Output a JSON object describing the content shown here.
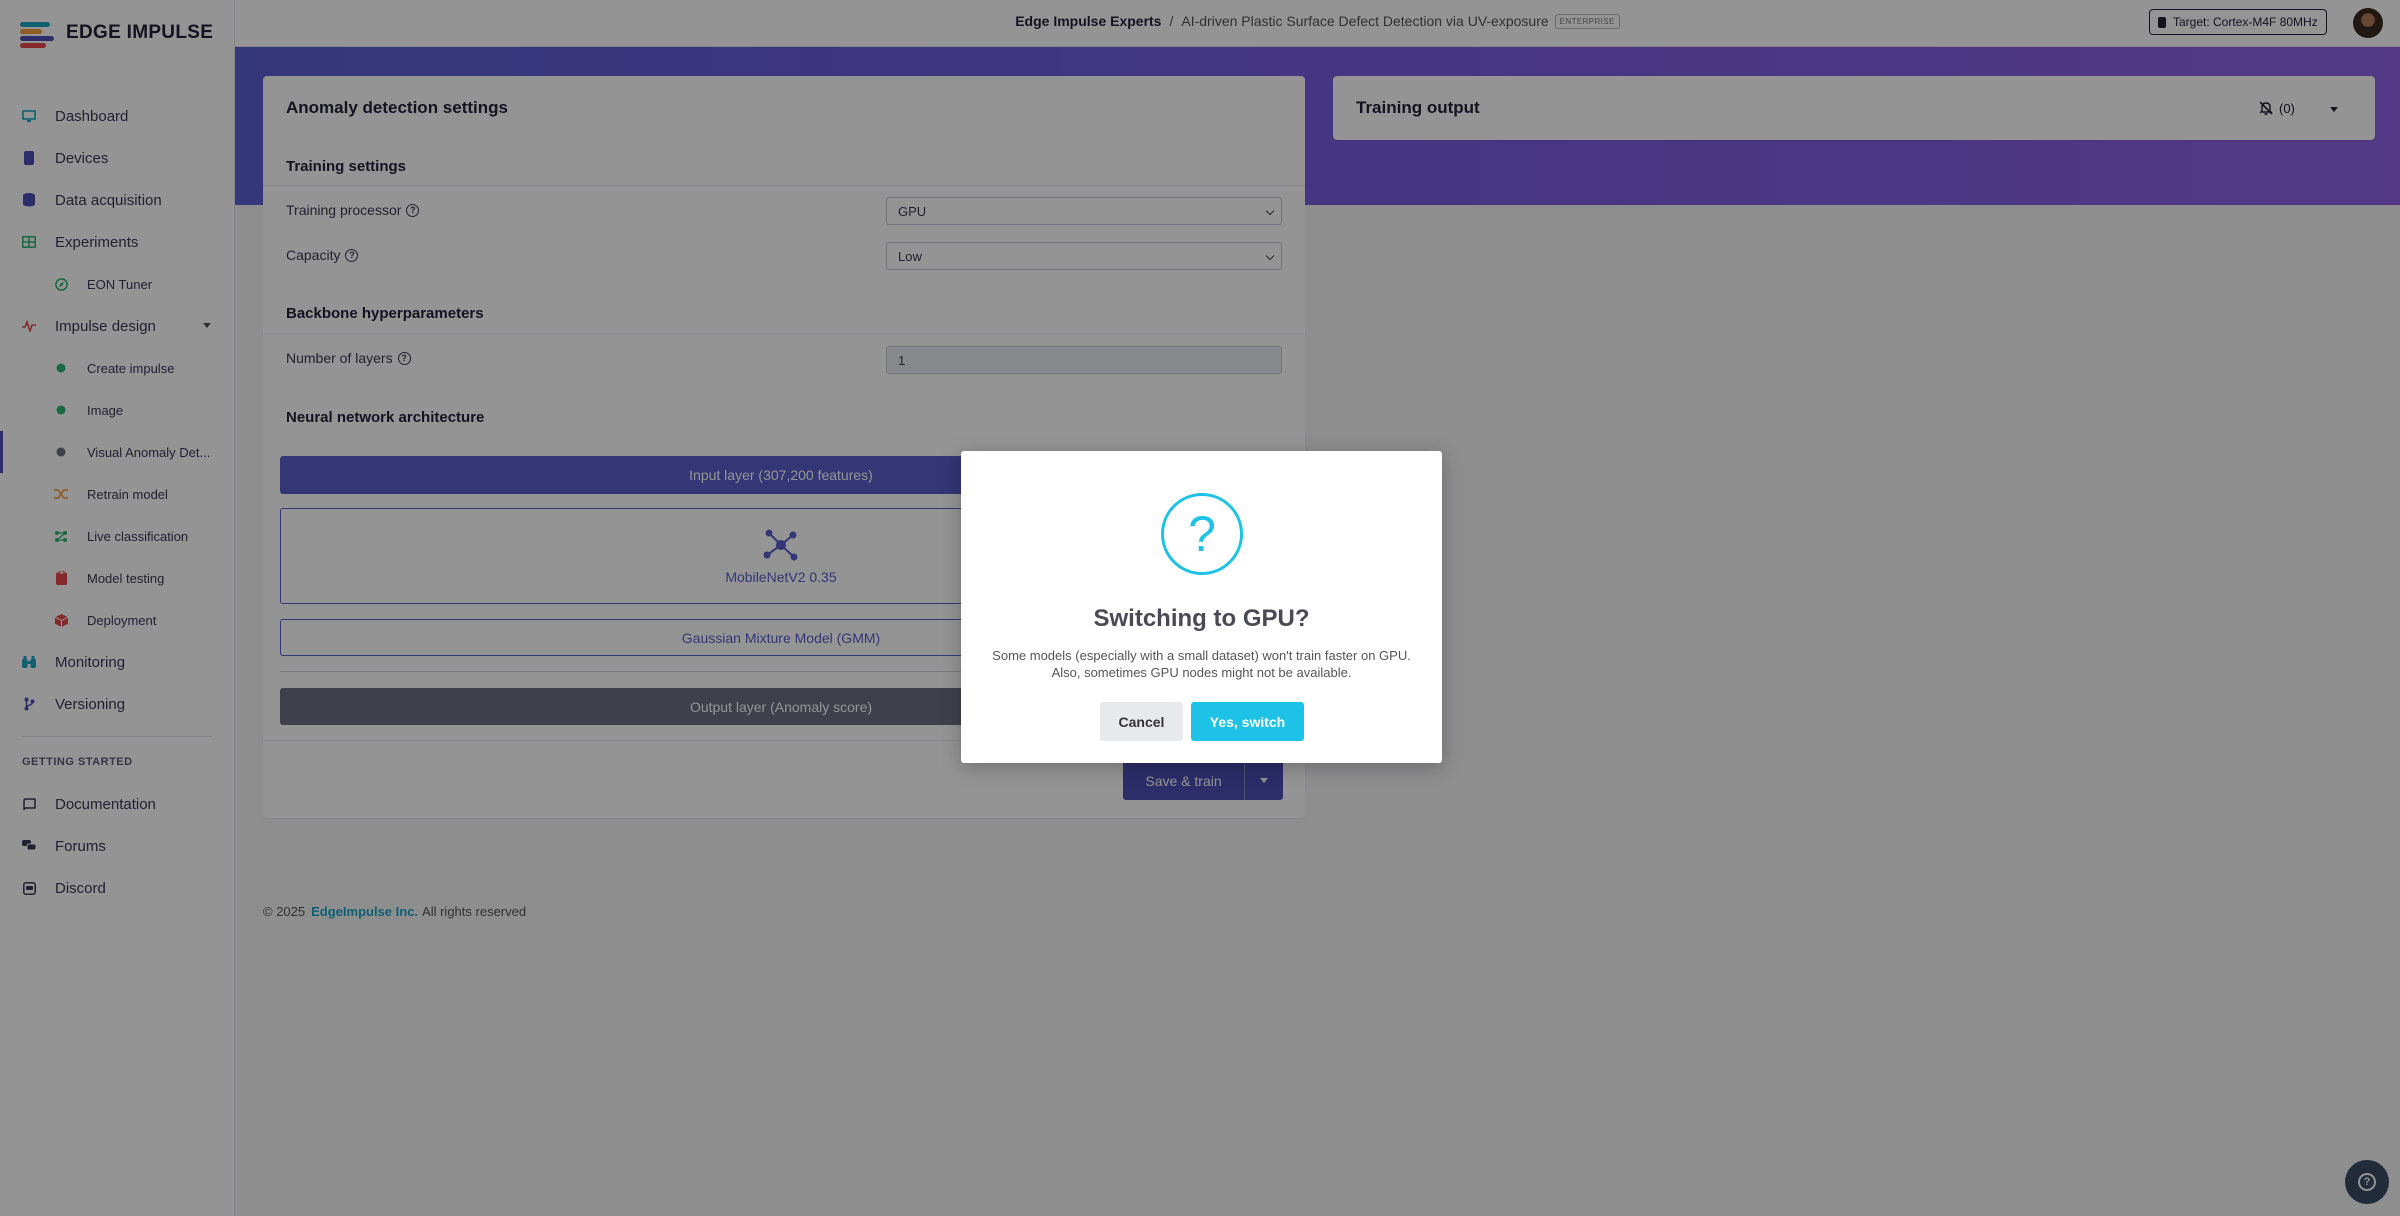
{
  "brand": {
    "name": "EDGE IMPULSE",
    "logo_colors": [
      "#1ea6c4",
      "#f3a33b",
      "#4d4fb5",
      "#e5484d"
    ]
  },
  "sidebar": {
    "items": [
      {
        "label": "Dashboard",
        "icon": "monitor-icon",
        "color": "#1ea6c4"
      },
      {
        "label": "Devices",
        "icon": "device-icon",
        "color": "#4d4fb5"
      },
      {
        "label": "Data acquisition",
        "icon": "database-icon",
        "color": "#4d4fb5"
      },
      {
        "label": "Experiments",
        "icon": "grid-icon",
        "color": "#2bb673"
      },
      {
        "label": "EON Tuner",
        "icon": "compass-icon",
        "color": "#2bb673"
      },
      {
        "label": "Impulse design",
        "icon": "pulse-icon",
        "color": "#e5484d"
      },
      {
        "label": "Create impulse",
        "icon": "dot-icon",
        "color": "#2bb673"
      },
      {
        "label": "Image",
        "icon": "dot-icon",
        "color": "#2bb673"
      },
      {
        "label": "Visual Anomaly Det...",
        "icon": "dot-icon",
        "color": "#6c6f82"
      },
      {
        "label": "Retrain model",
        "icon": "shuffle-icon",
        "color": "#f3a33b"
      },
      {
        "label": "Live classification",
        "icon": "network-icon",
        "color": "#2bb673"
      },
      {
        "label": "Model testing",
        "icon": "clipboard-icon",
        "color": "#e5484d"
      },
      {
        "label": "Deployment",
        "icon": "box-icon",
        "color": "#e5484d"
      },
      {
        "label": "Monitoring",
        "icon": "binoculars-icon",
        "color": "#1ea6c4"
      },
      {
        "label": "Versioning",
        "icon": "branch-icon",
        "color": "#4d4fb5"
      }
    ],
    "getting_started_title": "GETTING STARTED",
    "getting_started": [
      {
        "label": "Documentation",
        "icon": "book-icon"
      },
      {
        "label": "Forums",
        "icon": "chat-icon"
      },
      {
        "label": "Discord",
        "icon": "discord-icon"
      }
    ]
  },
  "topbar": {
    "org": "Edge Impulse Experts",
    "separator": "/",
    "project": "AI-driven Plastic Surface Defect Detection via UV-exposure",
    "badge": "ENTERPRISE",
    "target": "Target: Cortex-M4F 80MHz"
  },
  "settings": {
    "title": "Anomaly detection settings",
    "training_settings": "Training settings",
    "training_processor_label": "Training processor",
    "training_processor_value": "GPU",
    "capacity_label": "Capacity",
    "capacity_value": "Low",
    "backbone_title": "Backbone hyperparameters",
    "layers_label": "Number of layers",
    "layers_value": "1",
    "nn_title": "Neural network architecture",
    "input_layer": "Input layer (307,200 features)",
    "backbone_layer": "MobileNetV2 0.35",
    "gmm_layer": "Gaussian Mixture Model (GMM)",
    "output_layer": "Output layer (Anomaly score)",
    "save_button": "Save & train"
  },
  "output": {
    "title": "Training output",
    "notifications": "(0)"
  },
  "footer": {
    "copyright": "© 2025",
    "company": "EdgeImpulse Inc.",
    "rights": "All rights reserved"
  },
  "modal": {
    "icon_glyph": "?",
    "title": "Switching to GPU?",
    "text_line1": "Some models (especially with a small dataset) won't train faster on GPU.",
    "text_line2": "Also, sometimes GPU nodes might not be available.",
    "cancel": "Cancel",
    "confirm": "Yes, switch"
  }
}
